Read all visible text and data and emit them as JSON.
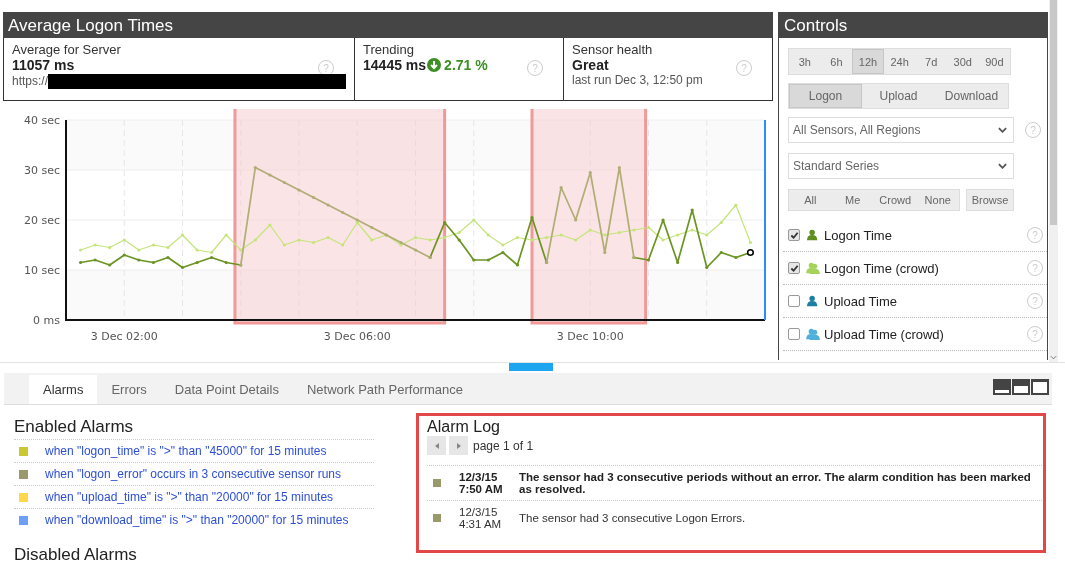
{
  "panel": {
    "title": "Average Logon Times"
  },
  "stats": [
    {
      "label": "Average for Server",
      "value": "11057 ms",
      "sub": "https://",
      "redacted": true,
      "help": "?"
    },
    {
      "label": "Trending",
      "value": "14445 ms",
      "change": "2.71 %",
      "help": "?"
    },
    {
      "label": "Sensor health",
      "value": "Great",
      "sub": "last run Dec 3, 12:50 pm",
      "help": "?"
    }
  ],
  "chart": {
    "chart_data": {
      "type": "line",
      "categories": [
        null,
        null,
        null,
        "3 Dec 02:00",
        null,
        null,
        null,
        null,
        null,
        null,
        null,
        null,
        null,
        null,
        null,
        null,
        null,
        null,
        null,
        "3 Dec 06:00",
        null,
        null,
        null,
        null,
        null,
        null,
        null,
        null,
        null,
        null,
        null,
        null,
        null,
        null,
        null,
        "3 Dec 10:00",
        null,
        null,
        null,
        null,
        null,
        null,
        null,
        null,
        null,
        null,
        null
      ],
      "ylim": [
        0,
        40
      ],
      "grid": true,
      "yticks": [
        {
          "value": 0,
          "label": "0 ms"
        },
        {
          "value": 10,
          "label": "10 sec"
        },
        {
          "value": 20,
          "label": "20 sec"
        },
        {
          "value": 30,
          "label": "30 sec"
        },
        {
          "value": 40,
          "label": "40 sec"
        }
      ],
      "series": [
        {
          "color": "#c5e47a",
          "values": [
            14,
            15,
            14.5,
            16,
            14,
            15,
            14.5,
            17,
            14,
            13.5,
            17,
            14,
            16,
            19,
            15,
            16,
            15.5,
            16.5,
            15,
            19.5,
            16,
            17,
            15,
            16.5,
            16,
            16.5,
            17.5,
            20,
            17,
            15,
            16.5,
            16,
            16.5,
            17,
            16,
            18,
            17,
            17.5,
            18,
            18.5,
            16,
            17,
            18,
            17,
            19.5,
            23,
            15.5
          ]
        },
        {
          "color": "#6b9422",
          "values": [
            11.5,
            12,
            11,
            13,
            12,
            11.5,
            12.5,
            10.5,
            11.5,
            12.5,
            11.5,
            11,
            null,
            null,
            null,
            null,
            null,
            null,
            null,
            null,
            null,
            null,
            null,
            null,
            12.5,
            19.5,
            16,
            12,
            12,
            13.5,
            11,
            20.5,
            11.5,
            null,
            null,
            null,
            null,
            null,
            12.5,
            12,
            20,
            11.5,
            22,
            10.5,
            13.5,
            12.5,
            13.5
          ]
        },
        {
          "color": "#b0ad76",
          "values": [
            null,
            null,
            null,
            null,
            null,
            null,
            null,
            null,
            null,
            null,
            null,
            11,
            30.5,
            29,
            27.5,
            26,
            24.5,
            23,
            21.5,
            20,
            18.5,
            17,
            15.5,
            14,
            12.5,
            null,
            null,
            null,
            null,
            null,
            null,
            null,
            11.5,
            26.5,
            20,
            29.5,
            13.5,
            30.5,
            12.5,
            null,
            null,
            null,
            null,
            null,
            null,
            null,
            null
          ]
        }
      ]
    }
  },
  "controls": {
    "title": "Controls",
    "ranges": [
      {
        "label": "3h",
        "selected": false
      },
      {
        "label": "6h",
        "selected": false
      },
      {
        "label": "12h",
        "selected": true
      },
      {
        "label": "24h",
        "selected": false
      },
      {
        "label": "7d",
        "selected": false
      },
      {
        "label": "30d",
        "selected": false
      },
      {
        "label": "90d",
        "selected": false
      }
    ],
    "metrics": [
      {
        "label": "Logon",
        "selected": true
      },
      {
        "label": "Upload",
        "selected": false
      },
      {
        "label": "Download",
        "selected": false
      }
    ],
    "region_select": {
      "value": "All Sensors, All Regions",
      "help": "?"
    },
    "series_select": {
      "value": "Standard Series"
    },
    "filters": [
      "All",
      "Me",
      "Crowd",
      "None"
    ],
    "browse": "Browse",
    "series": [
      {
        "label": "Logon Time",
        "checked": true,
        "kind": "single",
        "color": "#5f8f1f",
        "help": "?"
      },
      {
        "label": "Logon Time (crowd)",
        "checked": true,
        "kind": "crowd",
        "color": "#a6d25a",
        "help": "?"
      },
      {
        "label": "Upload Time",
        "checked": false,
        "kind": "single",
        "color": "#1d7fa3",
        "help": "?"
      },
      {
        "label": "Upload Time (crowd)",
        "checked": false,
        "kind": "crowd",
        "color": "#4fb0dc",
        "help": "?"
      }
    ]
  },
  "tabs": [
    {
      "label": "Alarms",
      "selected": true
    },
    {
      "label": "Errors",
      "selected": false
    },
    {
      "label": "Data Point Details",
      "selected": false
    },
    {
      "label": "Network Path Performance",
      "selected": false
    }
  ],
  "enabled_alarms": {
    "title": "Enabled Alarms",
    "items": [
      {
        "text": "when \"logon_time\" is \">\" than \"45000\" for 15 minutes",
        "color": "#c9c92e"
      },
      {
        "text": "when \"logon_error\" occurs in 3 consecutive sensor runs",
        "color": "#99996b"
      },
      {
        "text": "when \"upload_time\" is \">\" than \"20000\" for 15 minutes",
        "color": "#ffd84d"
      },
      {
        "text": "when \"download_time\" is \">\" than \"20000\" for 15 minutes",
        "color": "#6e9ff7"
      }
    ]
  },
  "disabled_alarms": {
    "title": "Disabled Alarms"
  },
  "alarm_log": {
    "title": "Alarm Log",
    "page": "page 1 of 1",
    "entries": [
      {
        "date": "12/3/15",
        "time": "7:50 AM",
        "message": "The sensor had 3 consecutive periods without an error. The alarm condition has been marked as resolved.",
        "bold": true,
        "color": "#99996b"
      },
      {
        "date": "12/3/15",
        "time": "4:31 AM",
        "message": "The sensor had 3 consecutive Logon Errors.",
        "bold": false,
        "color": "#99996b"
      }
    ]
  }
}
